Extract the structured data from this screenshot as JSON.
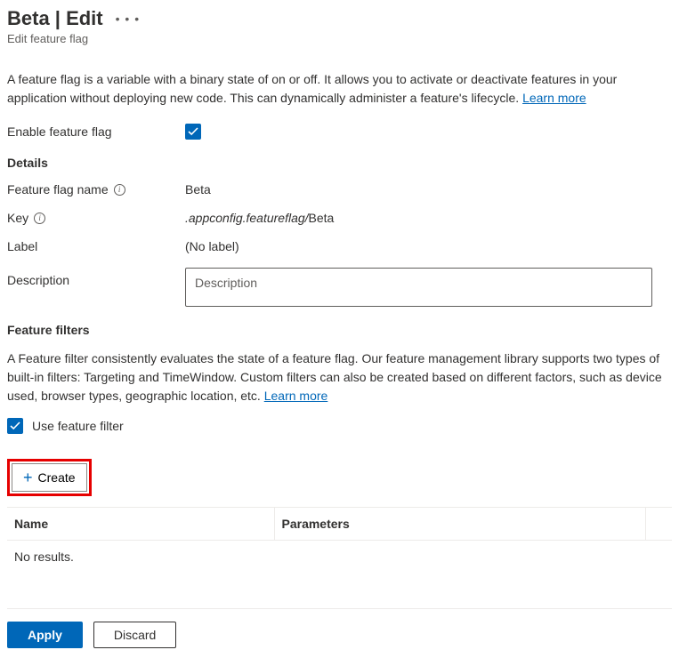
{
  "header": {
    "title": "Beta | Edit",
    "subtitle": "Edit feature flag"
  },
  "intro": {
    "text": "A feature flag is a variable with a binary state of on or off. It allows you to activate or deactivate features in your application without deploying new code. This can dynamically administer a feature's lifecycle. ",
    "link": "Learn more"
  },
  "enable": {
    "label": "Enable feature flag",
    "checked": true
  },
  "details": {
    "title": "Details",
    "name_label": "Feature flag name",
    "name_value": "Beta",
    "key_label": "Key",
    "key_prefix": ".appconfig.featureflag/",
    "key_name": "Beta",
    "label_label": "Label",
    "label_value": "(No label)",
    "description_label": "Description",
    "description_placeholder": "Description",
    "description_value": ""
  },
  "filters": {
    "title": "Feature filters",
    "description": "A Feature filter consistently evaluates the state of a feature flag. Our feature management library supports two types of built-in filters: Targeting and TimeWindow. Custom filters can also be created based on different factors, such as device used, browser types, geographic location, etc. ",
    "link": "Learn more",
    "use_filter_label": "Use feature filter",
    "use_filter_checked": true,
    "create_label": "Create",
    "columns": {
      "name": "Name",
      "parameters": "Parameters"
    },
    "empty": "No results."
  },
  "footer": {
    "apply": "Apply",
    "discard": "Discard"
  }
}
